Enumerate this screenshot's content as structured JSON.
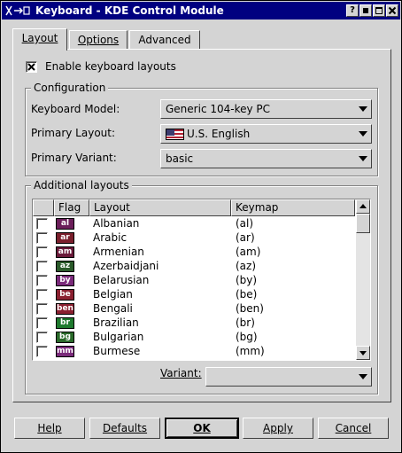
{
  "window": {
    "title": "Keyboard - KDE Control Module",
    "buttons": {
      "help": "?",
      "minimize": "▪",
      "maximize": "□",
      "close": "×"
    }
  },
  "tabs": [
    {
      "label": "Layout",
      "active": true
    },
    {
      "label": "Options",
      "active": false
    },
    {
      "label": "Advanced",
      "active": false
    }
  ],
  "enable_checkbox": {
    "label": "Enable keyboard layouts",
    "checked": true
  },
  "configuration": {
    "group_title": "Configuration",
    "model_label": "Keyboard Model:",
    "model_value": "Generic 104-key PC",
    "primary_layout_label": "Primary Layout:",
    "primary_layout_value": "U.S. English",
    "primary_variant_label": "Primary Variant:",
    "primary_variant_value": "basic"
  },
  "additional": {
    "group_title": "Additional layouts",
    "columns": [
      "",
      "Flag",
      "Layout",
      "Keymap"
    ],
    "rows": [
      {
        "flag": "al",
        "layout": "Albanian",
        "keymap": "(al)",
        "checked": false
      },
      {
        "flag": "ar",
        "layout": "Arabic",
        "keymap": "(ar)",
        "checked": false
      },
      {
        "flag": "am",
        "layout": "Armenian",
        "keymap": "(am)",
        "checked": false
      },
      {
        "flag": "az",
        "layout": "Azerbaidjani",
        "keymap": "(az)",
        "checked": false
      },
      {
        "flag": "by",
        "layout": "Belarusian",
        "keymap": "(by)",
        "checked": false
      },
      {
        "flag": "be",
        "layout": "Belgian",
        "keymap": "(be)",
        "checked": false
      },
      {
        "flag": "ben",
        "layout": "Bengali",
        "keymap": "(ben)",
        "checked": false
      },
      {
        "flag": "br",
        "layout": "Brazilian",
        "keymap": "(br)",
        "checked": false
      },
      {
        "flag": "bg",
        "layout": "Bulgarian",
        "keymap": "(bg)",
        "checked": false
      },
      {
        "flag": "mm",
        "layout": "Burmese",
        "keymap": "(mm)",
        "checked": false
      }
    ],
    "variant_label": "Variant:",
    "variant_value": ""
  },
  "footer": {
    "help": "Help",
    "defaults": "Defaults",
    "ok": "OK",
    "apply": "Apply",
    "cancel": "Cancel"
  },
  "colors": {
    "titlebar": "#000080",
    "window_bg": "#d4d4d4",
    "flag_al": "#6b1e5a",
    "flag_ar": "#7a1f2c",
    "flag_am": "#6a1a3a",
    "flag_az": "#2a5a2a",
    "flag_by": "#7a2a7a",
    "flag_be": "#8a2030",
    "flag_ben": "#8a2030",
    "flag_br": "#1e7a2e",
    "flag_bg": "#2a6a2a",
    "flag_mm": "#7a2a7a"
  }
}
